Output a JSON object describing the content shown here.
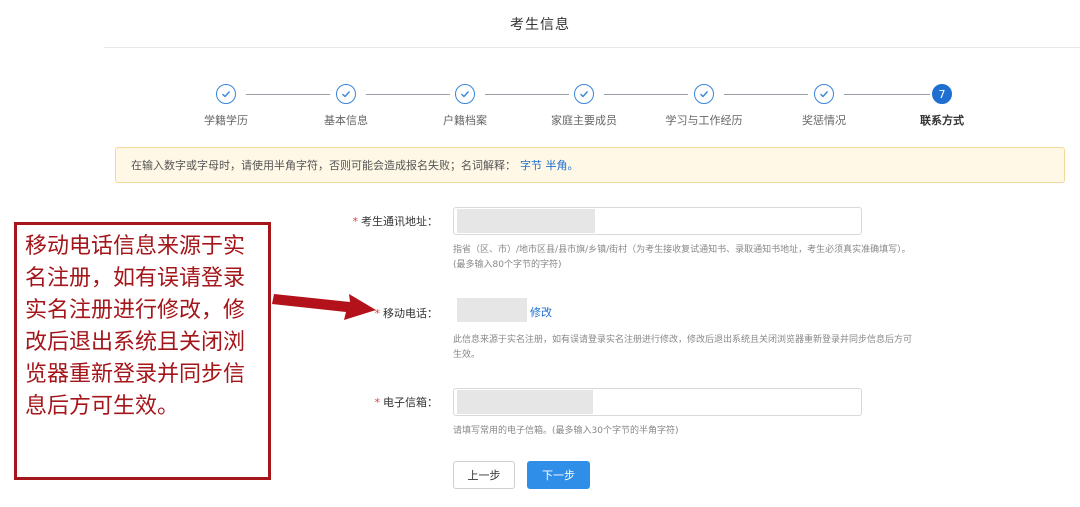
{
  "page_title": "考生信息",
  "steps": [
    {
      "label": "学籍学历",
      "done": true
    },
    {
      "label": "基本信息",
      "done": true
    },
    {
      "label": "户籍档案",
      "done": true
    },
    {
      "label": "家庭主要成员",
      "done": true
    },
    {
      "label": "学习与工作经历",
      "done": true
    },
    {
      "label": "奖惩情况",
      "done": true
    },
    {
      "label": "联系方式",
      "done": false,
      "number": "7"
    }
  ],
  "notice": {
    "text": "在输入数字或字母时，请使用半角字符，否则可能会造成报名失败；名词解释：",
    "link": "字节 半角。"
  },
  "form": {
    "address": {
      "label": "考生通讯地址：",
      "hint1": "指省（区、市）/地市区县/县市旗/乡镇/街村（为考生接收复试通知书、录取通知书地址，考生必须真实准确填写）。",
      "hint2": "(最多输入80个字节的字符)"
    },
    "mobile": {
      "label": "移动电话：",
      "modify": "修改",
      "hint1": "此信息来源于实名注册，如有误请登录实名注册进行修改，修改后退出系统且关闭浏览器重新登录并同步信息后方可",
      "hint2": "生效。"
    },
    "email": {
      "label": "电子信箱：",
      "hint": "请填写常用的电子信箱。(最多输入30个字节的半角字符)"
    },
    "required_mark": "*"
  },
  "buttons": {
    "prev": "上一步",
    "next": "下一步"
  },
  "annotation": {
    "text": "移动电话信息来源于实名注册，如有误请登录实名注册进行修改，修改后退出系统且关闭浏览器重新登录并同步信息后方可生效。"
  },
  "colors": {
    "primary": "#2f8ee8",
    "annotation": "#a4161a",
    "notice_bg": "#fff8e6"
  }
}
